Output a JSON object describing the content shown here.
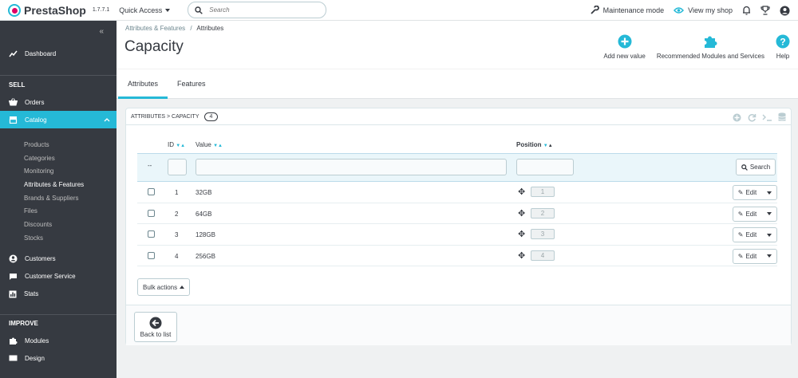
{
  "topbar": {
    "brand": "PrestaShop",
    "version": "1.7.7.1",
    "quick_access": "Quick Access",
    "search_placeholder": "Search",
    "maintenance": "Maintenance mode",
    "view_shop": "View my shop"
  },
  "sidebar": {
    "dashboard": "Dashboard",
    "sell_heading": "SELL",
    "orders": "Orders",
    "catalog": "Catalog",
    "catalog_items": [
      "Products",
      "Categories",
      "Monitoring",
      "Attributes & Features",
      "Brands & Suppliers",
      "Files",
      "Discounts",
      "Stocks"
    ],
    "customers": "Customers",
    "customer_service": "Customer Service",
    "stats": "Stats",
    "improve_heading": "IMPROVE",
    "modules": "Modules",
    "design": "Design"
  },
  "header": {
    "breadcrumb_parent": "Attributes & Features",
    "breadcrumb_sep": "/",
    "breadcrumb_current": "Attributes",
    "title": "Capacity",
    "add_new_value": "Add new value",
    "recommended_modules": "Recommended Modules and Services",
    "help": "Help"
  },
  "tabs": [
    "Attributes",
    "Features"
  ],
  "panel": {
    "heading": "Attributes > Capacity",
    "count": "4",
    "columns": {
      "id": "ID",
      "value": "Value",
      "position": "Position"
    },
    "filter_reset": "--",
    "search_button": "Search",
    "rows": [
      {
        "id": "1",
        "value": "32GB",
        "position": "1"
      },
      {
        "id": "2",
        "value": "64GB",
        "position": "2"
      },
      {
        "id": "3",
        "value": "128GB",
        "position": "3"
      },
      {
        "id": "4",
        "value": "256GB",
        "position": "4"
      }
    ],
    "edit_label": "Edit",
    "bulk_actions": "Bulk actions",
    "back_to_list": "Back to list"
  },
  "colors": {
    "accent": "#25b9d7",
    "sidebar": "#363a41",
    "text": "#363a41"
  }
}
